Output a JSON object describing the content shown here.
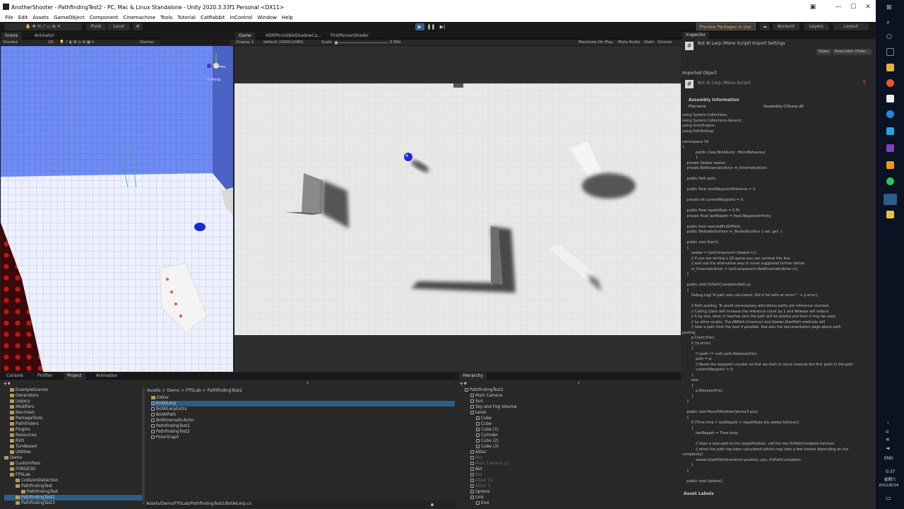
{
  "window": {
    "title": "AnotherShooter - PathfindingTest2 - PC, Mac & Linux Standalone - Unity 2020.3.33f1 Personal <DX11>",
    "min": "—",
    "max": "☐",
    "close": "✕"
  },
  "menu": [
    "File",
    "Edit",
    "Assets",
    "GameObject",
    "Component",
    "Cinemachine",
    "Tools",
    "Tutorial",
    "CatRabbit",
    "InControl",
    "Window",
    "Help"
  ],
  "toolbar": {
    "pivot": "Pivot",
    "local": "Local",
    "preview_packages": "Preview Packages in Use",
    "account": "Account",
    "layers": "Layers",
    "layout": "Layout",
    "play": "▶",
    "pause": "❚❚",
    "step": "▶|"
  },
  "scene": {
    "tabs": [
      "Scene",
      "Animator"
    ],
    "shading": "Shaded",
    "mode_2d": "2D",
    "gizmos": "Gizmos",
    "persp": "< Persp"
  },
  "game": {
    "tabs": [
      "Game",
      "HDRPInvisibleShadowCa...",
      "FirstPersonShader"
    ],
    "display": "Display 1",
    "resolution": "default (1920x1080)",
    "scale_label": "Scale",
    "scale_value": "0.68x",
    "maximize": "Maximize On Play",
    "mute": "Mute Audio",
    "stats": "Stats",
    "gizmos": "Gizmos"
  },
  "inspector": {
    "tab": "Inspector",
    "header_title": "Bot AI Lerp (Mono Script) Import Settings",
    "open": "Open",
    "execution_order": "Execution Order...",
    "imported_object": "Imported Object",
    "script_title": "Bot AI Lerp (Mono Script)",
    "assembly_info": "Assembly Information",
    "filename_label": "Filename",
    "filename_value": "Assembly-CSharp.dll",
    "asset_labels": "Asset Labels",
    "code": "using System.Collections;\nusing System.Collections.Generic;\nusing UnityEngine;\nusing Pathfinding;\n\nnamespace CR\n{\n            public class BotAILerp : MonoBehaviour\n            {\n    private Seeker seeker;\n    private BotKinematicActor m_KinematicActor;\n\n    public Path path;\n\n    public float nextWaypointDistance = 3;\n\n    private int currentWaypoint = 0;\n\n    public float repathRate = 0.5f;\n    private float lastRepath = float.NegativeInfinity;\n\n    public bool reachedEndOfPath;\n    public WalkableSurface m_BindedSurface { set; get; }\n\n    public void Start()\n    {\n        seeker = GetComponent<Seeker>();\n        // If you are writing a 2D game you can remove this line\n        // and use the alternative way to move suggested further below.\n        m_KinematicActor = GetComponent<BotKinematicActor>();\n    }\n\n    public void OnPathComplete(Path p)\n    {\n        Debug.Log(\"A path was calculated. Did it fail with an error? \" + p.error);\n\n        // Path pooling. To avoid unnecessary allocations paths are reference counted.\n        // Calling Claim will increase the reference count by 1 and Release will reduce\n        // it by one, when it reaches zero the path will be pooled and then it may be used\n        // by other scripts. The ABPath.Construct and Seeker.StartPath methods will\n        // take a path from the pool if possible. See also the documentation page about path\npooling.\n        p.Claim(this);\n        if (!p.error)\n        {\n            if (path != null) path.Release(this);\n            path = p;\n            // Reset the waypoint counter so that we start to move towards the first point in the path\n            currentWaypoint = 0;\n        }\n        else\n        {\n            p.Release(this);\n        }\n    }\n\n    public void MoveToPosition(Vector3 pos)\n    {\n        if (Time.time > lastRepath + repathRate && seeker.IsDone())\n        {\n            lastRepath = Time.time;\n\n            // Start a new path to the targetPosition, call the the OnPathComplete function\n            // when the path has been calculated (which may take a few frames depending on the\ncomplexity)\n            seeker.StartPath(transform.position, pos, OnPathComplete);\n        }\n    }\n\n    public void Update()"
  },
  "bottom": {
    "tabs": [
      "Console",
      "Profiler",
      "Project",
      "Animation"
    ],
    "breadcrumb": "Assets > Demo > FPSLab > PathfindingTest2",
    "path": "Assets/Demo/FPSLab/PathfindingTest2/BotAILerp.cs",
    "folders": [
      {
        "label": "ExampleScenes",
        "indent": 1
      },
      {
        "label": "Generators",
        "indent": 1
      },
      {
        "label": "Legacy",
        "indent": 1
      },
      {
        "label": "Modifiers",
        "indent": 1
      },
      {
        "label": "Navmesh",
        "indent": 1
      },
      {
        "label": "PackageTools",
        "indent": 1
      },
      {
        "label": "Pathfinders",
        "indent": 1
      },
      {
        "label": "Plugins",
        "indent": 1
      },
      {
        "label": "Resources",
        "indent": 1
      },
      {
        "label": "RVO",
        "indent": 1
      },
      {
        "label": "TurnBased",
        "indent": 1
      },
      {
        "label": "Utilities",
        "indent": 1
      },
      {
        "label": "Demo",
        "indent": 0
      },
      {
        "label": "CustomPass",
        "indent": 1
      },
      {
        "label": "FORGE3D",
        "indent": 1
      },
      {
        "label": "FPSLab",
        "indent": 1
      },
      {
        "label": "CollisionDetection",
        "indent": 2
      },
      {
        "label": "PathfindingTest",
        "indent": 2
      },
      {
        "label": "PathfindingTest",
        "indent": 3
      },
      {
        "label": "PathfindingTest2",
        "indent": 2
      },
      {
        "label": "PathfindingTest3",
        "indent": 2
      }
    ],
    "files": [
      "Editor",
      "BotAILerp",
      "BotAILerpExtra",
      "BotAIPath",
      "BotKinematicActor",
      "PathfindingTest2",
      "PathfindingTest2",
      "PolarGraph"
    ],
    "hierarchy_tab": "Hierarchy",
    "hierarchy": [
      {
        "label": "PathfindingTest2",
        "indent": 0,
        "dim": false
      },
      {
        "label": "Main Camera",
        "indent": 1,
        "dim": false
      },
      {
        "label": "Sun",
        "indent": 1,
        "dim": false
      },
      {
        "label": "Sky and Fog Volume",
        "indent": 1,
        "dim": false
      },
      {
        "label": "Level",
        "indent": 1,
        "dim": false
      },
      {
        "label": "Cube",
        "indent": 2,
        "dim": false
      },
      {
        "label": "Cube",
        "indent": 2,
        "dim": false
      },
      {
        "label": "Cube (1)",
        "indent": 2,
        "dim": false
      },
      {
        "label": "Cylinder",
        "indent": 2,
        "dim": false
      },
      {
        "label": "Cube (2)",
        "indent": 2,
        "dim": false
      },
      {
        "label": "Cube (3)",
        "indent": 2,
        "dim": false
      },
      {
        "label": "AStar",
        "indent": 1,
        "dim": false
      },
      {
        "label": "Bot",
        "indent": 1,
        "dim": true
      },
      {
        "label": "Main Camera (1)",
        "indent": 1,
        "dim": true
      },
      {
        "label": "Bot",
        "indent": 1,
        "dim": false
      },
      {
        "label": "Bot",
        "indent": 1,
        "dim": true
      },
      {
        "label": "AStar (1)",
        "indent": 1,
        "dim": true
      },
      {
        "label": "AStar 3",
        "indent": 1,
        "dim": true
      },
      {
        "label": "Sphere",
        "indent": 1,
        "dim": false
      },
      {
        "label": "Link",
        "indent": 1,
        "dim": false
      },
      {
        "label": "End",
        "indent": 2,
        "dim": false
      }
    ]
  },
  "taskbar": {
    "time": "0:37",
    "weekday": "星期六",
    "date": "2022/6/24",
    "lang": "ENG"
  }
}
